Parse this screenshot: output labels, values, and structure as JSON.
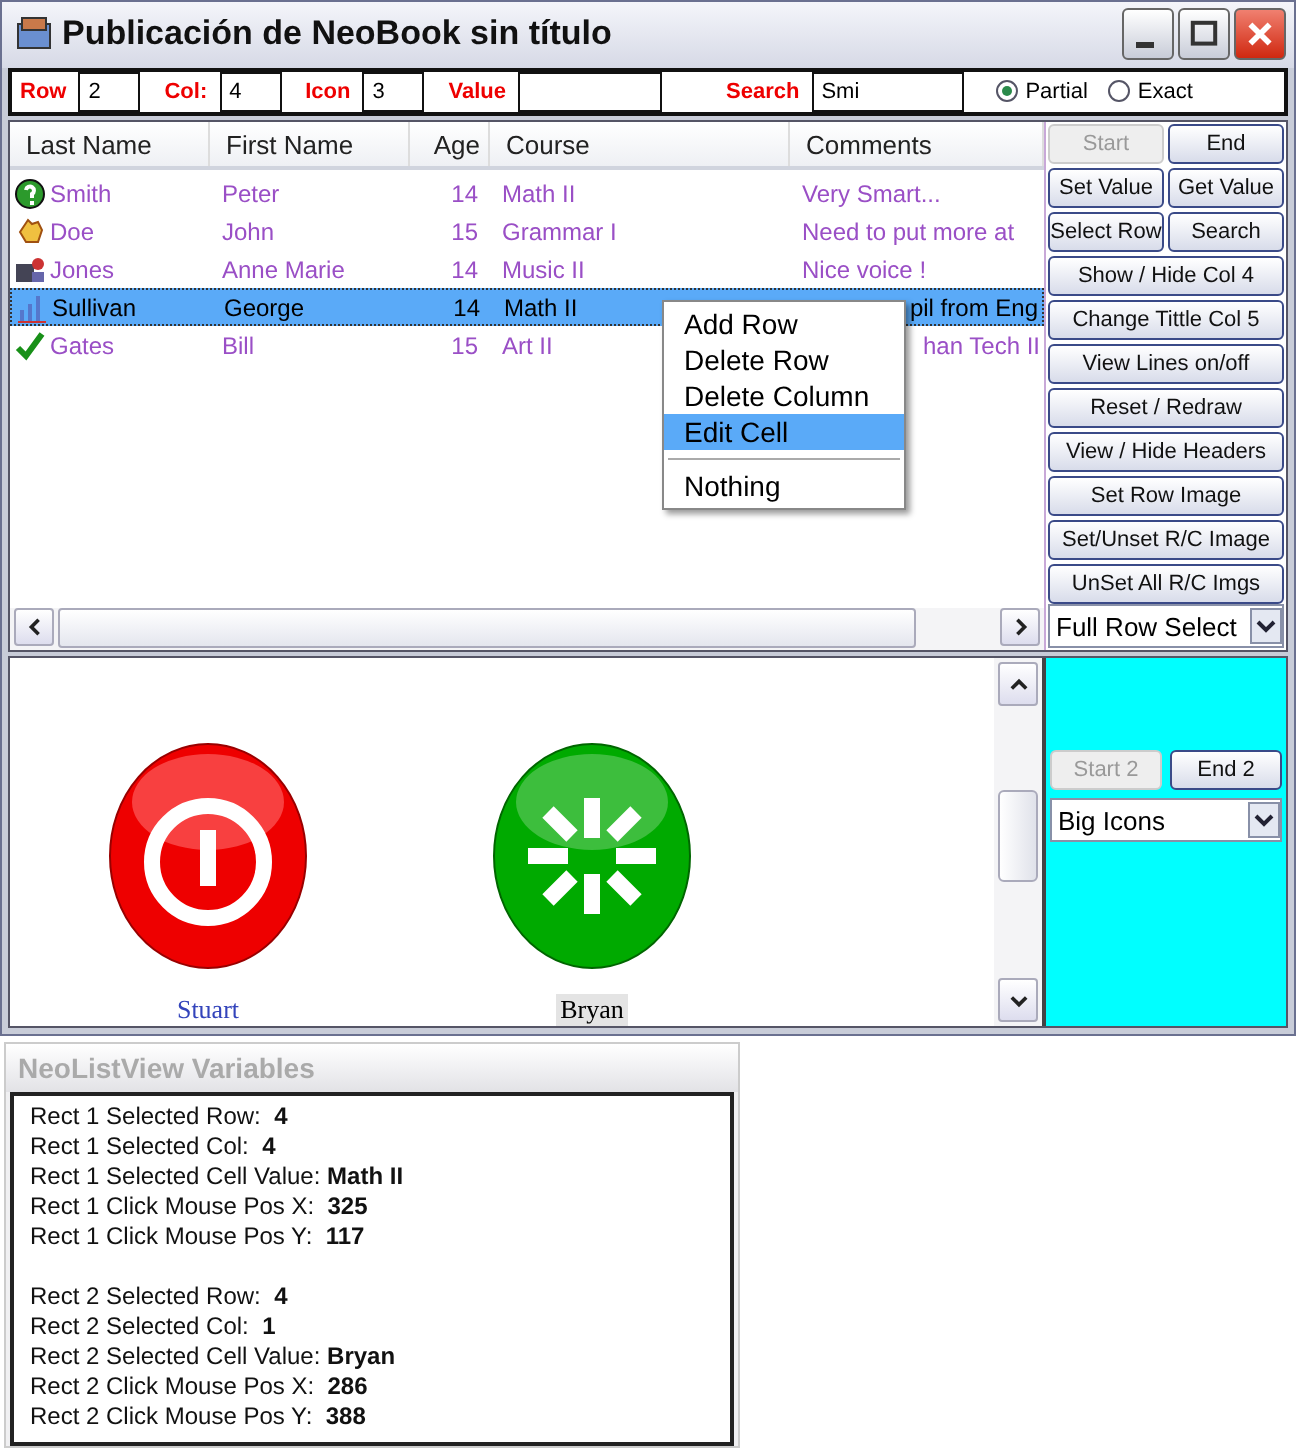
{
  "window": {
    "title": "Publicación de NeoBook sin título"
  },
  "toolbar": {
    "fields": [
      {
        "label": "Row",
        "value": "2"
      },
      {
        "label": "Col:",
        "value": "4"
      },
      {
        "label": "Icon",
        "value": "3"
      },
      {
        "label": "Value"
      },
      {
        "label": "Search",
        "value": "Smi"
      }
    ],
    "radios": [
      {
        "label": "Partial",
        "selected": true
      },
      {
        "label": "Exact",
        "selected": false
      }
    ]
  },
  "table": {
    "columns": [
      "Last Name",
      "First Name",
      "Age",
      "Course",
      "Comments"
    ],
    "rows": [
      {
        "cells": [
          "Smith",
          "Peter",
          "14",
          "Math II",
          "Very Smart..."
        ],
        "selected": false,
        "comment_covered": false
      },
      {
        "cells": [
          "Doe",
          "John",
          "15",
          "Grammar I",
          "Need to put more at"
        ],
        "selected": false,
        "comment_covered": false
      },
      {
        "cells": [
          "Jones",
          "Anne Marie",
          "14",
          "Music II",
          "Nice voice !"
        ],
        "selected": false,
        "comment_covered": false
      },
      {
        "cells": [
          "Sullivan",
          "George",
          "14",
          "Math II",
          "pil from Eng"
        ],
        "selected": true,
        "comment_covered": true
      },
      {
        "cells": [
          "Gates",
          "Bill",
          "15",
          "Art II",
          "han Tech II"
        ],
        "selected": false,
        "comment_covered": true
      }
    ],
    "context_menu": {
      "items": [
        {
          "label": "Add Row",
          "selected": false
        },
        {
          "label": "Delete Row",
          "selected": false
        },
        {
          "label": "Delete Column",
          "selected": false
        },
        {
          "label": "Edit Cell",
          "selected": true
        },
        {
          "label": "Nothing",
          "selected": false,
          "separator_before": true
        }
      ]
    }
  },
  "side_buttons": [
    {
      "label": "Start",
      "disabled": true,
      "wide": false
    },
    {
      "label": "End",
      "disabled": false,
      "wide": false
    },
    {
      "label": "Set Value",
      "disabled": false,
      "wide": false
    },
    {
      "label": "Get Value",
      "disabled": false,
      "wide": false
    },
    {
      "label": "Select Row",
      "disabled": false,
      "wide": false
    },
    {
      "label": "Search",
      "disabled": false,
      "wide": false
    },
    {
      "label": "Show / Hide Col 4",
      "disabled": false,
      "wide": true
    },
    {
      "label": "Change Tittle Col 5",
      "disabled": false,
      "wide": true
    },
    {
      "label": "View Lines on/off",
      "disabled": false,
      "wide": true
    },
    {
      "label": "Reset / Redraw",
      "disabled": false,
      "wide": true
    },
    {
      "label": "View / Hide Headers",
      "disabled": false,
      "wide": true
    },
    {
      "label": "Set Row Image",
      "disabled": false,
      "wide": true
    },
    {
      "label": "Set/Unset R/C Image",
      "disabled": false,
      "wide": true
    },
    {
      "label": "UnSet All R/C Imgs",
      "disabled": false,
      "wide": true
    }
  ],
  "row_mode": "Full Row Select",
  "icon_view": {
    "items": [
      {
        "label": "Stuart",
        "selected": false
      },
      {
        "label": "Bryan",
        "selected": true
      }
    ]
  },
  "panel2": {
    "buttons": [
      {
        "label": "Start 2",
        "disabled": true
      },
      {
        "label": "End 2",
        "disabled": false
      }
    ],
    "view_mode": "Big Icons"
  },
  "variables": {
    "title": "NeoListView Variables",
    "groups": [
      [
        "Rect 1 Selected Row:  **4**",
        "Rect 1 Selected Col:  **4**",
        "Rect 1 Selected Cell Value: **Math II**",
        "Rect 1 Click Mouse Pos X:  **325**",
        "Rect 1 Click Mouse Pos Y:  **117**"
      ],
      [
        "Rect 2 Selected Row:  **4**",
        "Rect 2 Selected Col:  **1**",
        "Rect 2 Selected Cell Value: **Bryan**",
        "Rect 2 Click Mouse Pos X:  **286**",
        "Rect 2 Click Mouse Pos Y:  **388**"
      ]
    ]
  }
}
